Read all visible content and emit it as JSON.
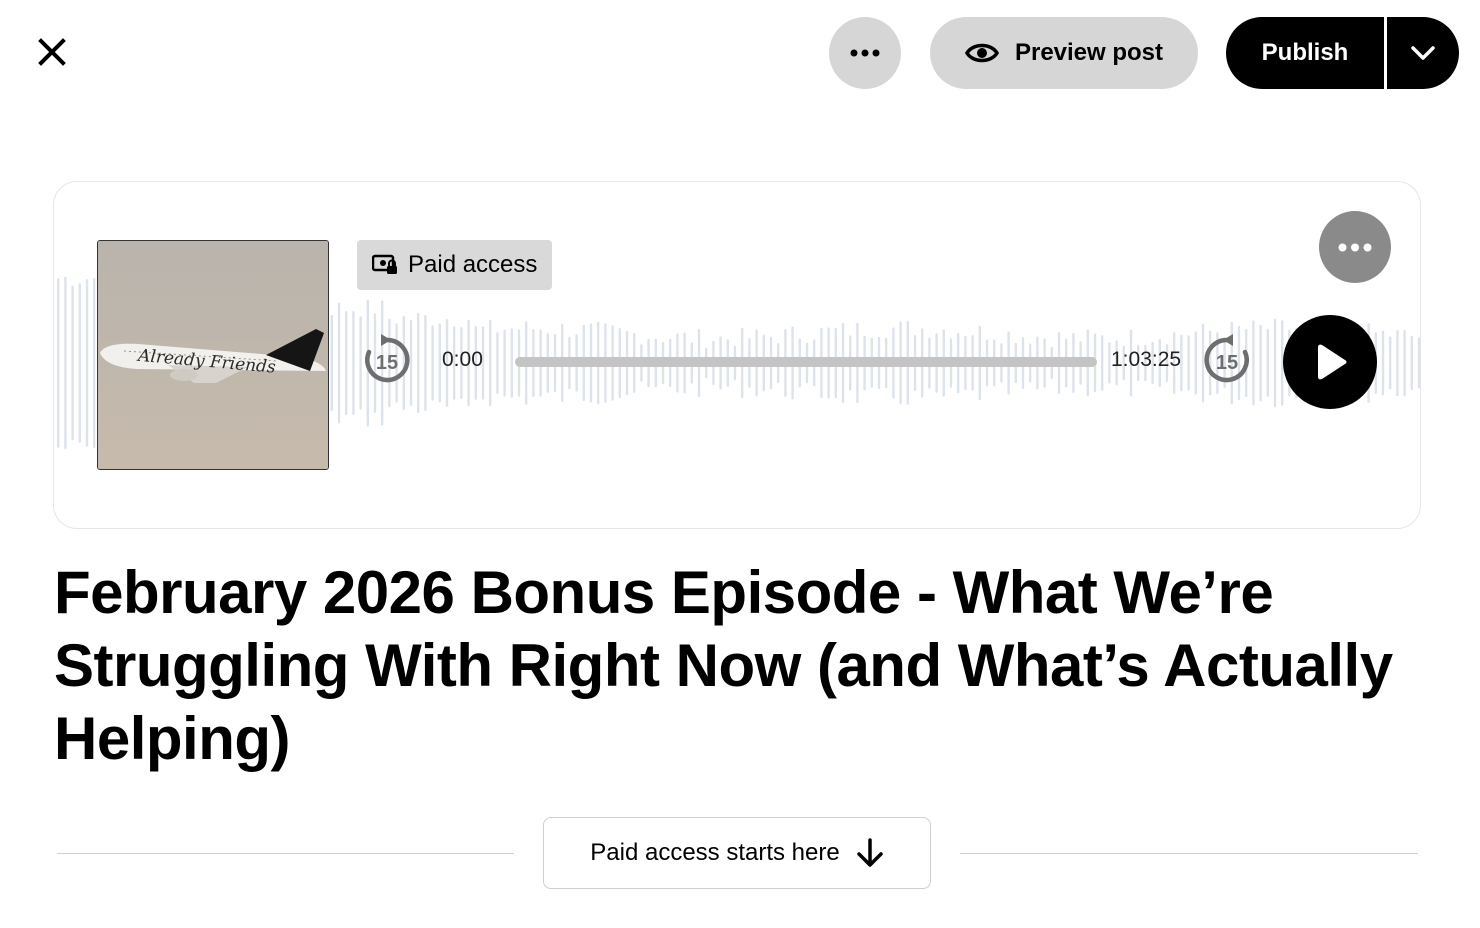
{
  "toolbar": {
    "close_icon": "close-icon",
    "more_icon": "more-horizontal-icon",
    "preview_label": "Preview post",
    "preview_icon": "eye-icon",
    "publish_label": "Publish",
    "publish_dropdown_icon": "chevron-down-icon"
  },
  "player": {
    "cover_text": "Already Friends",
    "paid_badge_label": "Paid access",
    "paid_badge_icon": "locked-money-icon",
    "skip_back_label": "15",
    "skip_forward_label": "15",
    "current_time": "0:00",
    "total_time": "1:03:25",
    "progress": 0,
    "play_icon": "play-icon",
    "more_icon": "more-horizontal-icon"
  },
  "post": {
    "title": "February 2026 Bonus Episode - What We’re Struggling With Right Now (and What’s Actually Helping)"
  },
  "paywall": {
    "label": "Paid access starts here",
    "icon": "arrow-down-icon"
  },
  "colors": {
    "accent": "#000000",
    "button_gray": "#d6d6d6",
    "waveform": "#dde3ec"
  }
}
